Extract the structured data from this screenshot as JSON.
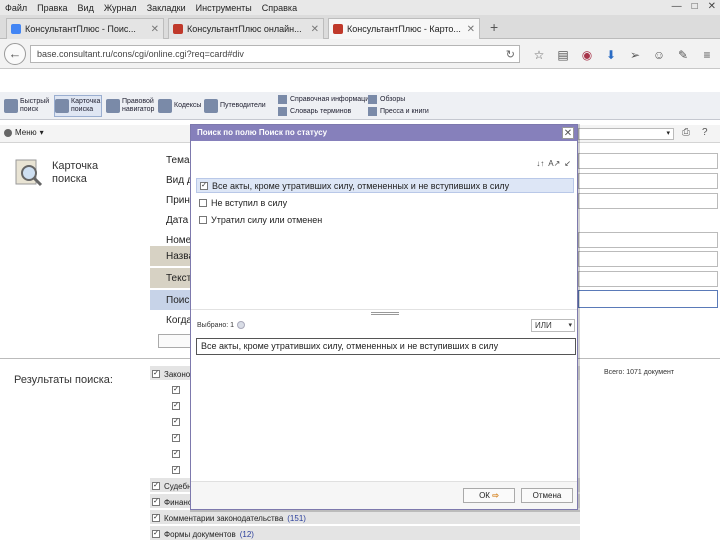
{
  "menu": [
    "Файл",
    "Правка",
    "Вид",
    "Журнал",
    "Закладки",
    "Инструменты",
    "Справка"
  ],
  "window_controls": [
    "—",
    "□",
    "✕"
  ],
  "tabs": [
    {
      "label": "КонсультантПлюс - Поис...",
      "favicon": "google-icon",
      "active": false
    },
    {
      "label": "КонсультантПлюс онлайн...",
      "favicon": "consultant-icon",
      "active": false
    },
    {
      "label": "КонсультантПлюс - Карто...",
      "favicon": "consultant-icon",
      "active": true
    }
  ],
  "new_tab": "+",
  "url": "base.consultant.ru/cons/cgi/online.cgi?req=card#div",
  "app_toolbar": [
    {
      "label": "Быстрый поиск"
    },
    {
      "label": "Карточка поиска",
      "selected": true
    },
    {
      "label": "Правовой навигатор"
    },
    {
      "label": "Кодексы"
    },
    {
      "label": "Путеводители"
    }
  ],
  "app_toolbar_right": [
    "Справочная информация",
    "Обзоры",
    "Словарь терминов",
    "Пресса и книги"
  ],
  "bar2_menu": "Меню",
  "card": {
    "title": "Карточка поиска"
  },
  "fields": [
    "Тема",
    "Вид документа",
    "Принявший орган",
    "Дата",
    "Номер",
    "Название документа",
    "Текст документа",
    "Поиск по статусу",
    "Когда получен"
  ],
  "results": {
    "label": "Результаты поиска:",
    "count": "Всего: 1071 документ",
    "sections": [
      {
        "name": "Законодательство",
        "count": "",
        "checked": true
      },
      {
        "name": "Судебная практика",
        "count": "",
        "checked": true
      },
      {
        "name": "Финансовые консультации",
        "count": "",
        "checked": true
      },
      {
        "name": "Комментарии законодательства",
        "count": "(151)",
        "checked": true
      },
      {
        "name": "Формы документов",
        "count": "(12)",
        "checked": true
      }
    ]
  },
  "modal": {
    "title": "Поиск по полю Поиск по статусу",
    "options": [
      {
        "label": "Все акты, кроме утративших силу, отмененных и не вступивших в силу",
        "checked": true
      },
      {
        "label": "Не вступил в силу",
        "checked": false
      },
      {
        "label": "Утратил силу или отменен",
        "checked": false
      }
    ],
    "selected_label": "Выбрано: 1",
    "logic": "ИЛИ",
    "selected_value": "Все акты, кроме утративших силу, отмененных и не вступивших в силу",
    "ok": "ОК",
    "cancel": "Отмена"
  }
}
